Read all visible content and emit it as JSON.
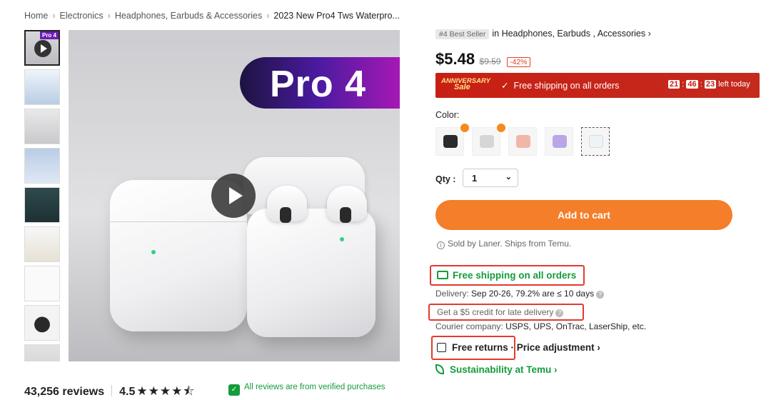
{
  "breadcrumb": {
    "items": [
      "Home",
      "Electronics",
      "Headphones, Earbuds & Accessories"
    ],
    "current": "2023 New Pro4 Tws Waterpro..."
  },
  "gallery": {
    "thumb_badge": "Pro 4",
    "banner_text": "Pro 4",
    "thumbnail_count": 9
  },
  "product": {
    "best_seller_tag": "#4 Best Seller",
    "best_seller_category": "in Headphones, Earbuds , Accessories",
    "price": "$5.48",
    "original_price": "$9.59",
    "discount": "-42%"
  },
  "promo": {
    "sale_line1": "ANNIVERSARY",
    "sale_line2": "Sale",
    "free_shipping": "Free shipping on all orders",
    "timer_h": "21",
    "timer_m": "46",
    "timer_s": "23",
    "timer_suffix": "left today"
  },
  "color": {
    "label": "Color:",
    "swatches": [
      {
        "name": "black",
        "color": "#2b2b2b"
      },
      {
        "name": "gray",
        "color": "#d6d6d6"
      },
      {
        "name": "pink",
        "color": "#f1b6a8"
      },
      {
        "name": "purple",
        "color": "#b9a6e6"
      },
      {
        "name": "white",
        "color": "#eef3f6"
      }
    ]
  },
  "quantity": {
    "label": "Qty :",
    "value": "1"
  },
  "cart": {
    "add_label": "Add to cart"
  },
  "seller": {
    "sold_by": "Sold by Laner. Ships from Temu."
  },
  "shipping": {
    "free_shipping": "Free shipping on all orders",
    "delivery_label": "Delivery:",
    "delivery_value": "Sep 20-26, 79.2% are ≤ 10 days",
    "credit_text": "Get a $5 credit for late delivery",
    "courier_label": "Courier company:",
    "courier_list": "USPS, UPS, OnTrac, LaserShip, etc."
  },
  "returns": {
    "free_returns": "Free returns",
    "price_adjustment": "Price adjustment",
    "arrow": "›"
  },
  "sustainability": {
    "label": "Sustainability at Temu",
    "arrow": "›"
  },
  "reviews": {
    "count": "43,256 reviews",
    "rating": "4.5",
    "stars": "★★★★⯪",
    "verified_text": "All reviews are from verified purchases"
  },
  "colors": {
    "accent_orange": "#f47e2a",
    "promo_red": "#c81f14",
    "green": "#159b3c",
    "highlight_red": "#e23b2e"
  }
}
